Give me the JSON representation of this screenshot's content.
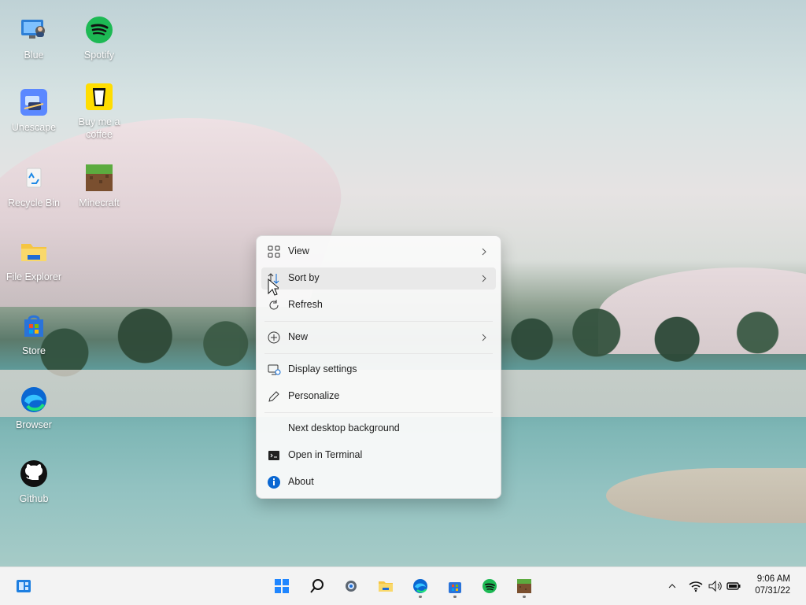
{
  "desktop_icons": [
    {
      "label": "Blue",
      "icon": "user-monitor-icon"
    },
    {
      "label": "Spotify",
      "icon": "spotify-icon"
    },
    {
      "label": "Unescape",
      "icon": "unescape-icon"
    },
    {
      "label": "Buy me a coffee",
      "icon": "coffee-cup-icon"
    },
    {
      "label": "Recycle Bin",
      "icon": "recycle-bin-icon"
    },
    {
      "label": "Minecraft",
      "icon": "minecraft-grass-block-icon"
    },
    {
      "label": "File Explorer",
      "icon": "folder-icon"
    },
    {
      "label": "Store",
      "icon": "store-bag-icon"
    },
    {
      "label": "Browser",
      "icon": "edge-browser-icon"
    },
    {
      "label": "Github",
      "icon": "github-icon"
    }
  ],
  "context_menu": {
    "items": [
      {
        "label": "View",
        "icon": "grid-view-icon",
        "has_submenu": true
      },
      {
        "label": "Sort by",
        "icon": "sort-arrows-icon",
        "has_submenu": true,
        "highlighted": true
      },
      {
        "label": "Refresh",
        "icon": "refresh-icon",
        "has_submenu": false
      },
      {
        "label": "New",
        "icon": "plus-circle-icon",
        "has_submenu": true
      },
      {
        "label": "Display settings",
        "icon": "display-settings-icon",
        "has_submenu": false
      },
      {
        "label": "Personalize",
        "icon": "pen-icon",
        "has_submenu": false
      },
      {
        "label": "Next desktop background",
        "icon": "",
        "has_submenu": false
      },
      {
        "label": "Open in Terminal",
        "icon": "terminal-icon",
        "has_submenu": false
      },
      {
        "label": "About",
        "icon": "info-icon",
        "has_submenu": false
      }
    ]
  },
  "taskbar": {
    "widgets_icon": "widgets-icon",
    "center_icons": [
      {
        "name": "start-windows-icon",
        "running": false
      },
      {
        "name": "search-icon",
        "running": false
      },
      {
        "name": "settings-gear-icon",
        "running": false
      },
      {
        "name": "file-explorer-folder-icon",
        "running": false
      },
      {
        "name": "edge-browser-icon",
        "running": true
      },
      {
        "name": "store-bag-icon",
        "running": true
      },
      {
        "name": "spotify-icon",
        "running": false
      },
      {
        "name": "minecraft-grass-block-icon",
        "running": true
      }
    ],
    "tray_icons": [
      "chevron-up-icon",
      "wifi-icon",
      "volume-icon",
      "battery-icon"
    ],
    "clock": {
      "time": "9:06 AM",
      "date": "07/31/22"
    }
  },
  "colors": {
    "accent_blue": "#0a67d2",
    "spotify_green": "#1db954",
    "folder_yellow": "#f5c542",
    "menu_bg": "#fafafa",
    "taskbar_bg": "#f3f3f3"
  }
}
